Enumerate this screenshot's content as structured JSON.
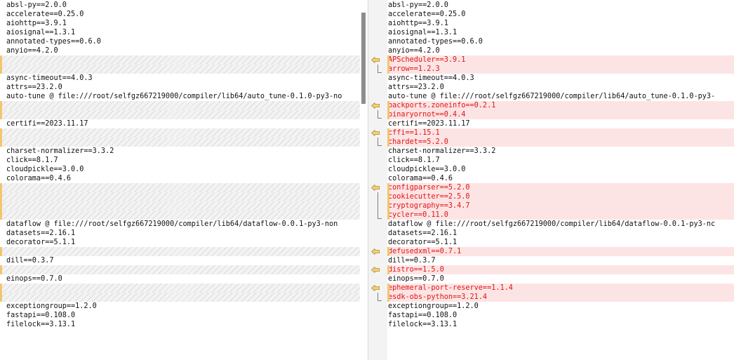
{
  "accent_colors": {
    "added_line_bg": "#fde4e4",
    "added_line_text": "#e01414",
    "change_marker": "#f2c66d"
  },
  "left_lines": [
    {
      "type": "same",
      "text": "absl-py==2.0.0"
    },
    {
      "type": "same",
      "text": "accelerate==0.25.0"
    },
    {
      "type": "same",
      "text": "aiohttp==3.9.1"
    },
    {
      "type": "same",
      "text": "aiosignal==1.3.1"
    },
    {
      "type": "same",
      "text": "annotated-types==0.6.0"
    },
    {
      "type": "same",
      "text": "anyio==4.2.0"
    },
    {
      "type": "gap",
      "text": ""
    },
    {
      "type": "gap",
      "text": ""
    },
    {
      "type": "same",
      "text": "async-timeout==4.0.3"
    },
    {
      "type": "same",
      "text": "attrs==23.2.0"
    },
    {
      "type": "same",
      "text": "auto-tune @ file:///root/selfgz667219000/compiler/lib64/auto_tune-0.1.0-py3-no"
    },
    {
      "type": "gap",
      "text": ""
    },
    {
      "type": "gap",
      "text": ""
    },
    {
      "type": "same",
      "text": "certifi==2023.11.17"
    },
    {
      "type": "gap",
      "text": ""
    },
    {
      "type": "gap",
      "text": ""
    },
    {
      "type": "same",
      "text": "charset-normalizer==3.3.2"
    },
    {
      "type": "same",
      "text": "click==8.1.7"
    },
    {
      "type": "same",
      "text": "cloudpickle==3.0.0"
    },
    {
      "type": "same",
      "text": "colorama==0.4.6"
    },
    {
      "type": "gap",
      "text": ""
    },
    {
      "type": "gap",
      "text": ""
    },
    {
      "type": "gap",
      "text": ""
    },
    {
      "type": "gap",
      "text": ""
    },
    {
      "type": "same",
      "text": "dataflow @ file:///root/selfgz667219000/compiler/lib64/dataflow-0.0.1-py3-non"
    },
    {
      "type": "same",
      "text": "datasets==2.16.1"
    },
    {
      "type": "same",
      "text": "decorator==5.1.1"
    },
    {
      "type": "gap",
      "text": ""
    },
    {
      "type": "same",
      "text": "dill==0.3.7"
    },
    {
      "type": "gap",
      "text": ""
    },
    {
      "type": "same",
      "text": "einops==0.7.0"
    },
    {
      "type": "gap",
      "text": ""
    },
    {
      "type": "gap",
      "text": ""
    },
    {
      "type": "same",
      "text": "exceptiongroup==1.2.0"
    },
    {
      "type": "same",
      "text": "fastapi==0.108.0"
    },
    {
      "type": "same",
      "text": "filelock==3.13.1"
    }
  ],
  "right_lines": [
    {
      "type": "same",
      "text": "absl-py==2.0.0"
    },
    {
      "type": "same",
      "text": "accelerate==0.25.0"
    },
    {
      "type": "same",
      "text": "aiohttp==3.9.1"
    },
    {
      "type": "same",
      "text": "aiosignal==1.3.1"
    },
    {
      "type": "same",
      "text": "annotated-types==0.6.0"
    },
    {
      "type": "same",
      "text": "anyio==4.2.0"
    },
    {
      "type": "add",
      "text": "APScheduler==3.9.1"
    },
    {
      "type": "add",
      "text": "arrow==1.2.3"
    },
    {
      "type": "same",
      "text": "async-timeout==4.0.3"
    },
    {
      "type": "same",
      "text": "attrs==23.2.0"
    },
    {
      "type": "same",
      "text": "auto-tune @ file:///root/selfgz667219000/compiler/lib64/auto_tune-0.1.0-py3-"
    },
    {
      "type": "add",
      "text": "backports.zoneinfo==0.2.1"
    },
    {
      "type": "add",
      "text": "binaryornot==0.4.4"
    },
    {
      "type": "same",
      "text": "certifi==2023.11.17"
    },
    {
      "type": "add",
      "text": "cffi==1.15.1"
    },
    {
      "type": "add",
      "text": "chardet==5.2.0"
    },
    {
      "type": "same",
      "text": "charset-normalizer==3.3.2"
    },
    {
      "type": "same",
      "text": "click==8.1.7"
    },
    {
      "type": "same",
      "text": "cloudpickle==3.0.0"
    },
    {
      "type": "same",
      "text": "colorama==0.4.6"
    },
    {
      "type": "add",
      "text": "configparser==5.2.0"
    },
    {
      "type": "add",
      "text": "cookiecutter==2.5.0"
    },
    {
      "type": "add",
      "text": "cryptography==3.4.7"
    },
    {
      "type": "add",
      "text": "cycler==0.11.0"
    },
    {
      "type": "same",
      "text": "dataflow @ file:///root/selfgz667219000/compiler/lib64/dataflow-0.0.1-py3-nc"
    },
    {
      "type": "same",
      "text": "datasets==2.16.1"
    },
    {
      "type": "same",
      "text": "decorator==5.1.1"
    },
    {
      "type": "add",
      "text": "defusedxml==0.7.1"
    },
    {
      "type": "same",
      "text": "dill==0.3.7"
    },
    {
      "type": "add",
      "text": "distro==1.5.0"
    },
    {
      "type": "same",
      "text": "einops==0.7.0"
    },
    {
      "type": "add",
      "text": "ephemeral-port-reserve==1.1.4"
    },
    {
      "type": "add",
      "text": "esdk-obs-python==3.21.4"
    },
    {
      "type": "same",
      "text": "exceptiongroup==1.2.0"
    },
    {
      "type": "same",
      "text": "fastapi==0.108.0"
    },
    {
      "type": "same",
      "text": "filelock==3.13.1"
    }
  ],
  "gutter_icons": {
    "copy_arrow": "arrow-left-icon"
  }
}
